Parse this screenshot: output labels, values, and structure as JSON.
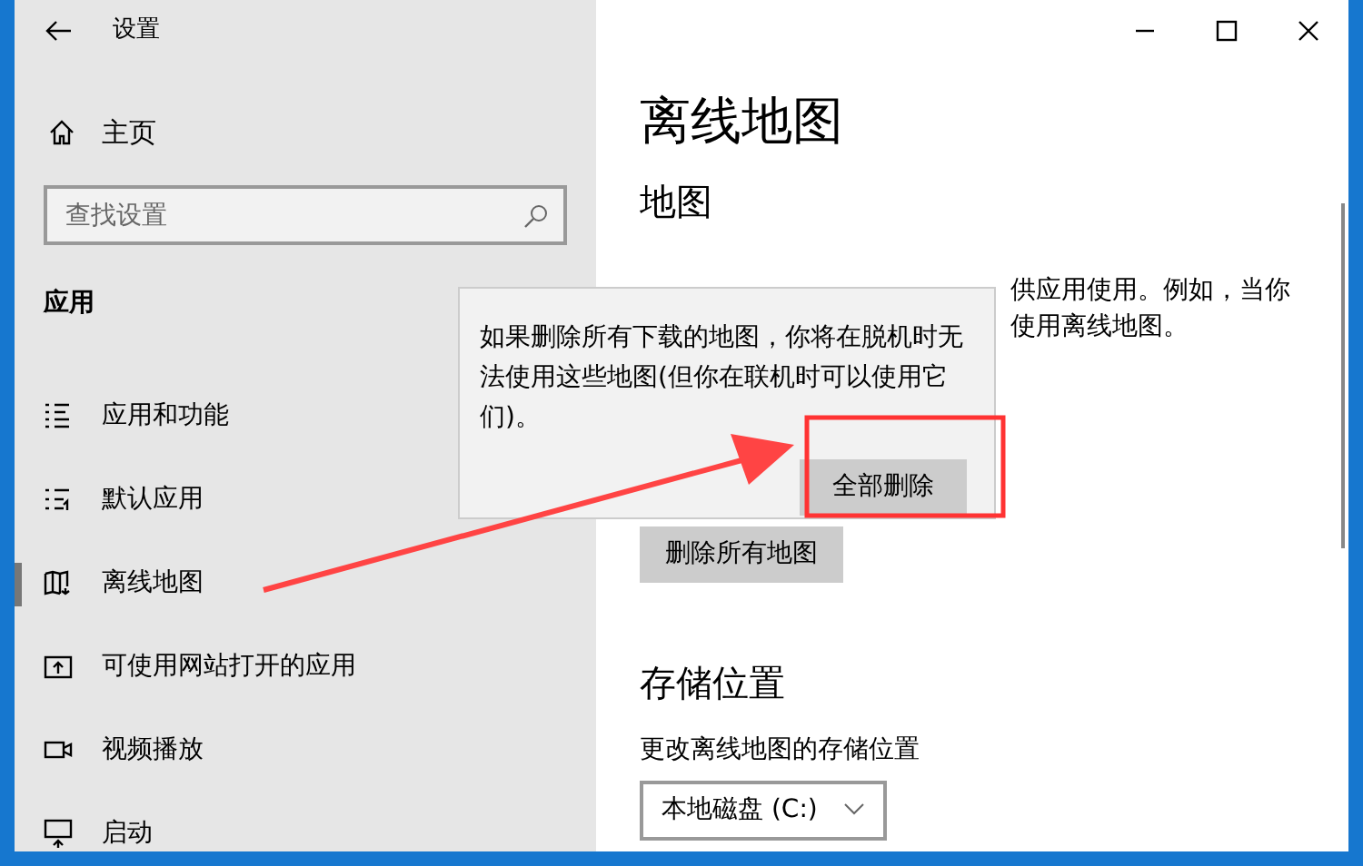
{
  "window": {
    "title": "设置"
  },
  "sidebar": {
    "home": "主页",
    "search": {
      "placeholder": "查找设置"
    },
    "section": "应用",
    "items": [
      {
        "label": "应用和功能",
        "selected": false
      },
      {
        "label": "默认应用",
        "selected": false
      },
      {
        "label": "离线地图",
        "selected": true
      },
      {
        "label": "可使用网站打开的应用",
        "selected": false
      },
      {
        "label": "视频播放",
        "selected": false
      },
      {
        "label": "启动",
        "selected": false
      }
    ]
  },
  "content": {
    "heading": "离线地图",
    "section_title": "地图",
    "description_fragments": [
      "供应用使用。例如，当你",
      "使用离线地图。"
    ],
    "delete_button": "删除所有地图",
    "storage": {
      "title": "存储位置",
      "label": "更改离线地图的存储位置",
      "dropdown": "本地磁盘 (C:)"
    }
  },
  "flyout": {
    "message": "如果删除所有下载的地图，你将在脱机时无法使用这些地图(但你在联机时可以使用它们)。",
    "button": "全部删除"
  }
}
